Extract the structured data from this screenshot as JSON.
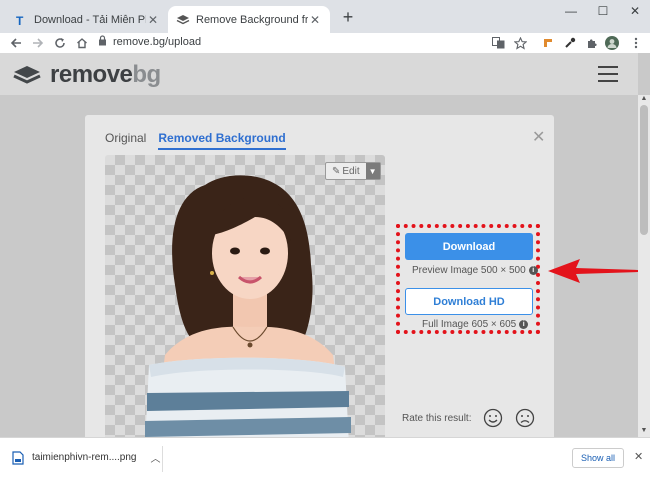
{
  "browser": {
    "tabs": [
      {
        "title": "Download - Tải Miễn Phí VN - Ph",
        "favicon": "taimienphi-t-icon"
      },
      {
        "title": "Remove Background from Image",
        "favicon": "removebg-icon"
      }
    ],
    "url": "remove.bg/upload",
    "window_controls": {
      "minimize": "—",
      "maximize": "☐",
      "close": "✕"
    }
  },
  "site": {
    "logo_main": "remove",
    "logo_suffix": "bg"
  },
  "card": {
    "tab_original": "Original",
    "tab_removed": "Removed Background",
    "edit_label": "Edit",
    "download_button": "Download",
    "preview_note": "Preview Image 500 × 500",
    "download_hd_button": "Download HD",
    "full_note": "Full Image 605 × 605",
    "rate_label": "Rate this result:"
  },
  "download_bar": {
    "filename": "taimienphivn-rem....png",
    "show_all": "Show all"
  },
  "colors": {
    "accent_blue": "#3b90e8",
    "highlight_red": "#e3131b"
  }
}
